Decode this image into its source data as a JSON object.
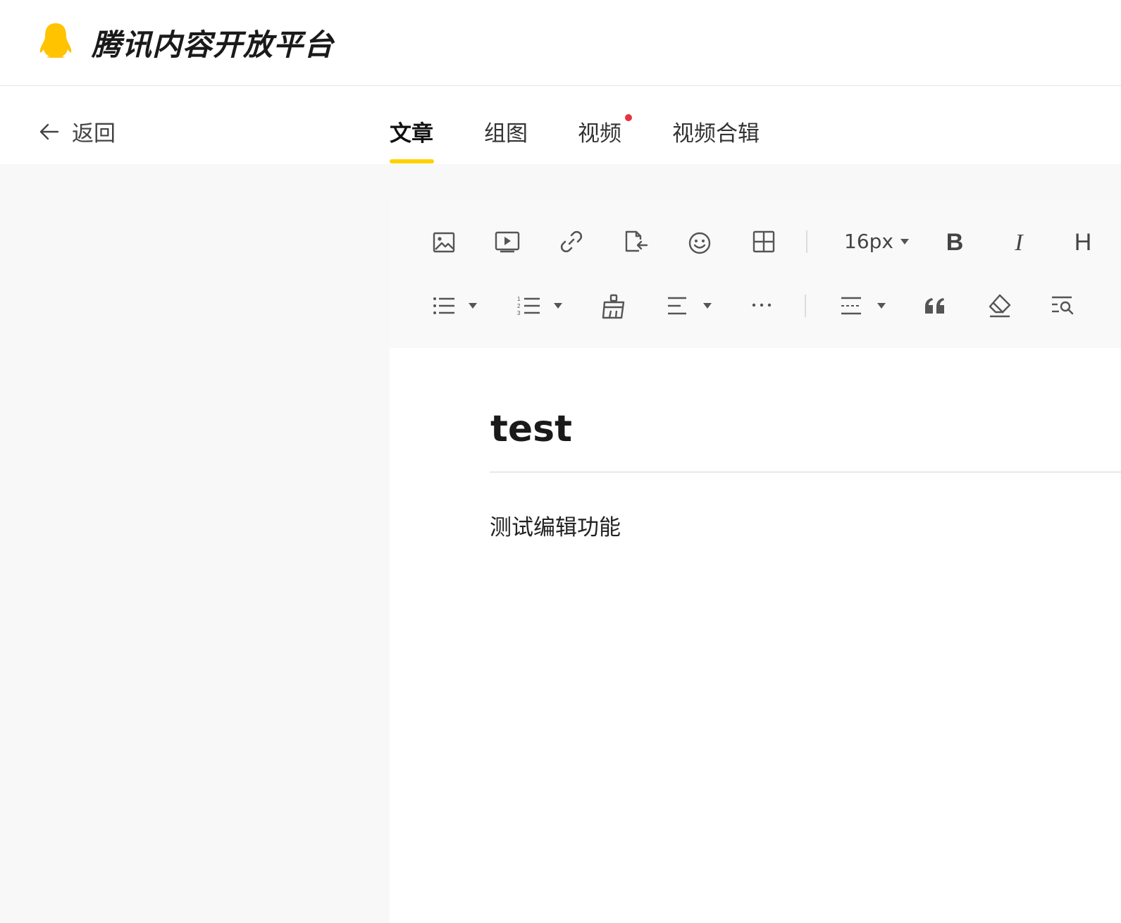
{
  "header": {
    "brand": "腾讯内容开放平台",
    "logo_icon": "penguin-icon",
    "logo_color": "#ffc300"
  },
  "nav": {
    "back_label": "返回",
    "tabs": [
      {
        "label": "文章",
        "active": true
      },
      {
        "label": "组图",
        "active": false
      },
      {
        "label": "视频",
        "active": false,
        "has_dot": true
      },
      {
        "label": "视频合辑",
        "active": false
      }
    ],
    "accent_color": "#ffd100",
    "dot_color": "#e8333f"
  },
  "toolbar": {
    "row1": [
      "image-icon",
      "video-icon",
      "link-icon",
      "import-file-icon",
      "emoji-icon",
      "table-icon",
      "font-size-select",
      "bold-icon",
      "italic-icon",
      "heading-icon"
    ],
    "row2": [
      "bullet-list-icon",
      "ordered-list-icon",
      "format-painter-icon",
      "align-icon",
      "more-icon",
      "divider-icon",
      "quote-icon",
      "eraser-icon",
      "find-replace-icon"
    ],
    "font_size": "16px",
    "bold_label": "B",
    "italic_label": "I",
    "heading_label": "H"
  },
  "article": {
    "title": "test",
    "body": "测试编辑功能"
  }
}
